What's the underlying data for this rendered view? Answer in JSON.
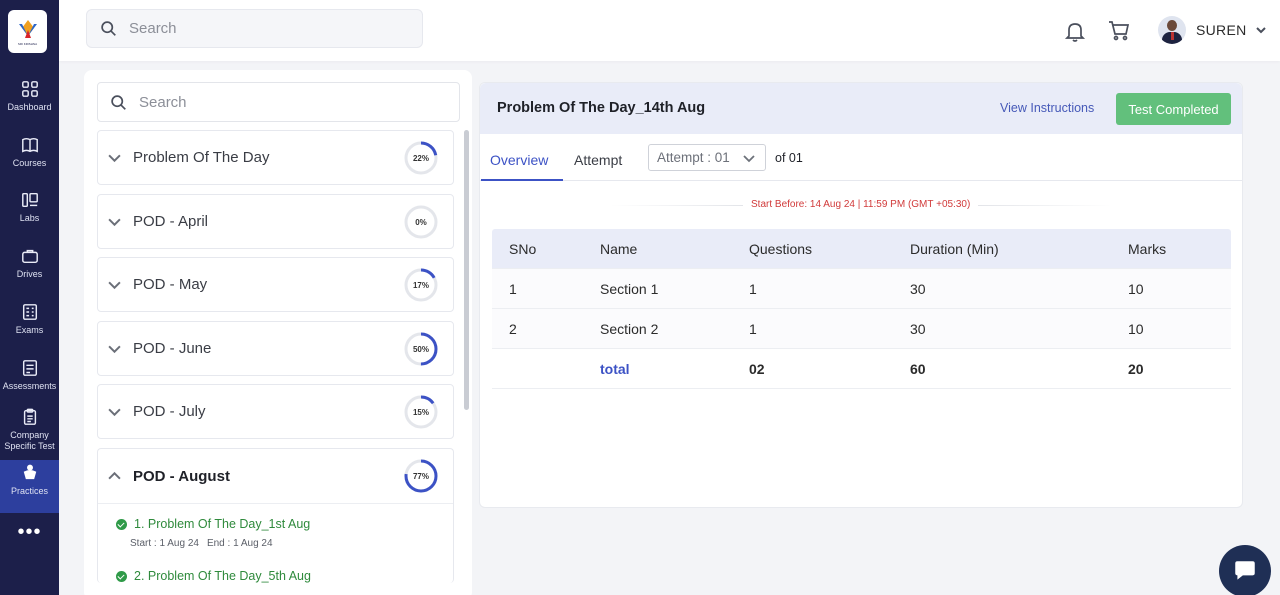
{
  "sidebar": {
    "logo_tag": "SRI KRISHNA",
    "items": [
      {
        "label": "Dashboard",
        "icon": "grid-icon"
      },
      {
        "label": "Courses",
        "icon": "book-icon"
      },
      {
        "label": "Labs",
        "icon": "lab-icon"
      },
      {
        "label": "Drives",
        "icon": "briefcase-icon"
      },
      {
        "label": "Exams",
        "icon": "exam-icon"
      },
      {
        "label": "Assessments",
        "icon": "assessment-icon"
      },
      {
        "label": "Company Specific Test",
        "icon": "clipboard-icon"
      },
      {
        "label": "Practices",
        "icon": "practice-icon"
      }
    ],
    "more": "•••"
  },
  "topbar": {
    "search_placeholder": "Search",
    "user_name": "SUREN"
  },
  "left": {
    "search_placeholder": "Search",
    "groups": [
      {
        "title": "Problem Of The Day",
        "percent": 22
      },
      {
        "title": "POD - April",
        "percent": 0
      },
      {
        "title": "POD - May",
        "percent": 17
      },
      {
        "title": "POD - June",
        "percent": 50
      },
      {
        "title": "POD - July",
        "percent": 15
      },
      {
        "title": "POD - August",
        "percent": 77
      }
    ],
    "percent_labels": [
      "22%",
      "0%",
      "17%",
      "50%",
      "15%",
      "77%"
    ],
    "open_items": [
      {
        "title": "1. Problem Of The Day_1st Aug",
        "start": "Start : 1 Aug 24",
        "end": "End : 1 Aug 24"
      },
      {
        "title": "2. Problem Of The Day_5th Aug",
        "start": "",
        "end": ""
      }
    ]
  },
  "main": {
    "title": "Problem Of The Day_14th Aug",
    "view_instructions": "View Instructions",
    "status_button": "Test Completed",
    "tabs": [
      "Overview",
      "Attempt"
    ],
    "attempt_select": "Attempt : 01",
    "of_text": "of 01",
    "start_before": "Start Before: 14 Aug 24 | 11:59 PM (GMT +05:30)",
    "table": {
      "headers": [
        "SNo",
        "Name",
        "Questions",
        "Duration (Min)",
        "Marks"
      ],
      "rows": [
        [
          "1",
          "Section 1",
          "1",
          "30",
          "10"
        ],
        [
          "2",
          "Section 2",
          "1",
          "30",
          "10"
        ]
      ],
      "total": [
        "",
        "total",
        "02",
        "60",
        "20"
      ]
    }
  }
}
